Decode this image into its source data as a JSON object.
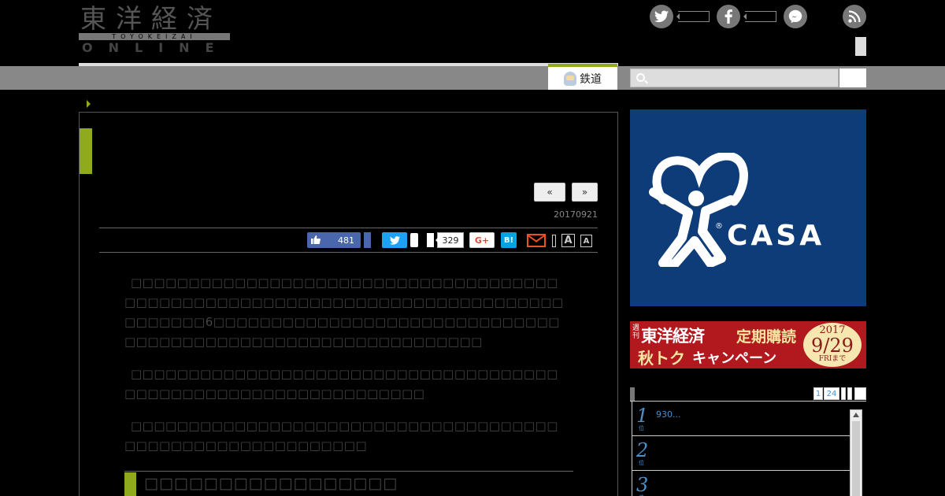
{
  "header": {
    "logo_kanji": "東洋経済",
    "logo_roman": "TOYOKEIZAI",
    "logo_online": "ONLINE"
  },
  "nav": {
    "active_tab": "鉄道"
  },
  "search": {
    "placeholder": ""
  },
  "article": {
    "prev_label": "«",
    "next_label": "»",
    "date": "20170921",
    "share": {
      "facebook_count": "481",
      "hatena_count": "329",
      "gplus_label": "G+",
      "hatebu_label": "B!",
      "font_large_label": "A",
      "font_small_label": "A"
    },
    "paragraphs": [
      "□□□□□□□□□□□□□□□□□□□□□□□□□□□□□□□□□□□□□□□□□□□□□□□□□□□□□□□□□□□□□□□□□□□□□□□□□□□□□□□□□□6□□□□□□□□□□□□□□□□□□□□□□□□□□□□□□□□□□□□□□□□□□□□□□□□□□□□□□□□□□□□□",
      "□□□□□□□□□□□□□□□□□□□□□□□□□□□□□□□□□□□□□□□□□□□□□□□□□□□□□□□□□□□□□□□",
      "□□□□□□□□□□□□□□□□□□□□□□□□□□□□□□□□□□□□□□□□□□□□□□□□□□□□□□□□□□"
    ],
    "subheading": "□□□□□□□□□□□□□□□□□"
  },
  "sidebar": {
    "ad_casa": {
      "brand": "CASA",
      "reg": "®"
    },
    "ad_subscription": {
      "weekly": "週刊",
      "brand": "東洋経済",
      "regular": "定期購読",
      "campaign_a": "秋トク",
      "campaign_b": "キャンペーン",
      "year": "2017",
      "day": "9/29",
      "day_tail": "FRIまで"
    },
    "ranking": {
      "tabs": [
        "1",
        "24"
      ],
      "items": [
        {
          "rank": "1",
          "suffix": "位",
          "text": "930..."
        },
        {
          "rank": "2",
          "suffix": "位",
          "text": ""
        },
        {
          "rank": "3",
          "suffix": "位",
          "text": ""
        }
      ]
    }
  },
  "colors": {
    "accent_green": "#8faa1c",
    "casa_blue": "#0d3c78",
    "subscription_red": "#b1191e",
    "facebook": "#4a66ad",
    "twitter": "#1da1f2"
  }
}
